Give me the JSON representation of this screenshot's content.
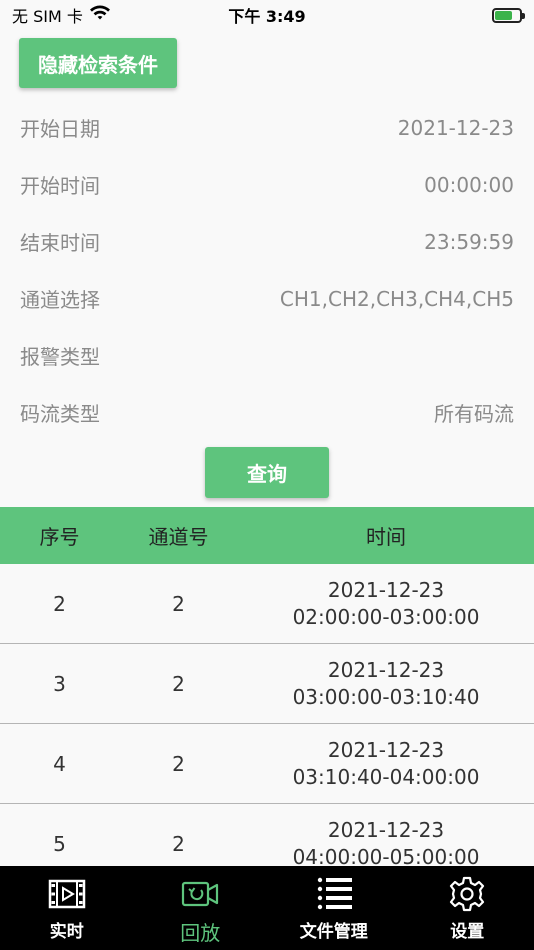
{
  "status_bar": {
    "carrier": "无 SIM 卡",
    "time": "下午 3:49"
  },
  "hide_button": {
    "label": "隐藏检索条件"
  },
  "form": {
    "rows": [
      {
        "label": "开始日期",
        "value": "2021-12-23"
      },
      {
        "label": "开始时间",
        "value": "00:00:00"
      },
      {
        "label": "结束时间",
        "value": "23:59:59"
      },
      {
        "label": "通道选择",
        "value": "CH1,CH2,CH3,CH4,CH5"
      },
      {
        "label": "报警类型",
        "value": ""
      },
      {
        "label": "码流类型",
        "value": "所有码流"
      }
    ]
  },
  "query_button": {
    "label": "查询"
  },
  "table": {
    "headers": {
      "index": "序号",
      "channel": "通道号",
      "time": "时间"
    },
    "rows": [
      {
        "index": "2",
        "channel": "2",
        "date": "2021-12-23",
        "range": "02:00:00-03:00:00"
      },
      {
        "index": "3",
        "channel": "2",
        "date": "2021-12-23",
        "range": "03:00:00-03:10:40"
      },
      {
        "index": "4",
        "channel": "2",
        "date": "2021-12-23",
        "range": "03:10:40-04:00:00"
      },
      {
        "index": "5",
        "channel": "2",
        "date": "2021-12-23",
        "range": "04:00:00-05:00:00"
      }
    ]
  },
  "tabbar": {
    "tabs": [
      {
        "label": "实时",
        "icon": "film-icon",
        "active": false
      },
      {
        "label": "回放",
        "icon": "playback-camera-icon",
        "active": true
      },
      {
        "label": "文件管理",
        "icon": "list-icon",
        "active": false
      },
      {
        "label": "设置",
        "icon": "gear-icon",
        "active": false
      }
    ],
    "active_color": "#5ec47d"
  },
  "colors": {
    "accent": "#5ec47d",
    "battery": "#3bb34a"
  }
}
